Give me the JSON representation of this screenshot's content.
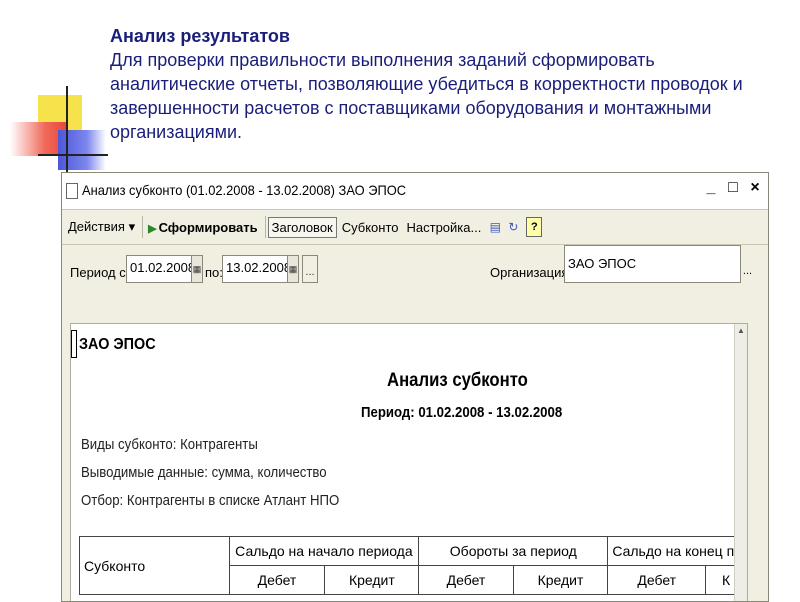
{
  "slide": {
    "title": "Анализ результатов",
    "text": "Для проверки правильности выполнения заданий сформировать аналитические отчеты, позволяющие убедиться в корректности проводок и завершенности расчетов с поставщиками оборудования и монтажными организациями."
  },
  "window": {
    "title": "Анализ субконто (01.02.2008 - 13.02.2008) ЗАО ЭПОС",
    "controls": {
      "minimize": "_",
      "maximize": "□",
      "close": "×"
    }
  },
  "toolbar": {
    "actions": "Действия ▾",
    "run": "Сформировать",
    "header": "Заголовок",
    "subkonto": "Субконто",
    "settings": "Настройка...",
    "help": "?"
  },
  "filters": {
    "period_from_label": "Период с:",
    "period_from": "01.02.2008",
    "period_to_label": "по:",
    "period_to": "13.02.2008",
    "dots": "...",
    "org_label": "Организация:",
    "org_value": "ЗАО ЭПОС"
  },
  "report": {
    "org": "ЗАО ЭПОС",
    "title": "Анализ субконто",
    "period": "Период: 01.02.2008 - 13.02.2008",
    "line1": "Виды субконто: Контрагенты",
    "line2": "Выводимые данные: сумма, количество",
    "line3": "Отбор: Контрагенты в списке Атлант НПО",
    "table": {
      "col_subkonto": "Субконто",
      "col_open": "Сальдо на начало периода",
      "col_turnover": "Обороты за период",
      "col_close": "Сальдо на конец пе",
      "debit": "Дебет",
      "credit": "Кредит",
      "credit_cut": "К"
    }
  }
}
